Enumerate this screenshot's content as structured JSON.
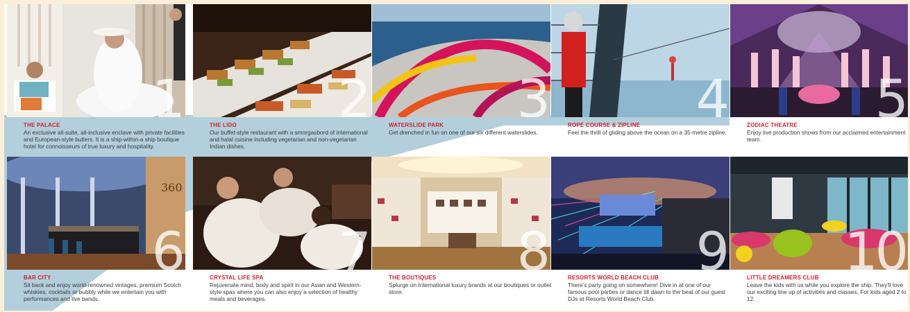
{
  "colors": {
    "accent": "#d0202f",
    "band": "#a6c7d6",
    "page": "#fcefd9"
  },
  "cards": [
    {
      "number": "1",
      "title": "THE PALACE",
      "desc": "An exclusive all-suite, all-inclusive enclave with private facilities and European-style butlers. It is a ship-within-a ship boutique hotel for connoisseurs of true luxury and hospitality."
    },
    {
      "number": "2",
      "title": "THE LIDO",
      "desc": "Our buffet-style restaurant with a smorgasbord of international and halal cuisine including vegetarian and non-vegetarian Indian dishes."
    },
    {
      "number": "3",
      "title": "WATERSLIDE PARK",
      "desc": "Get drenched in fun on one of our six different waterslides."
    },
    {
      "number": "4",
      "title": "ROPE COURSE & ZIPLINE",
      "desc": "Feel the thrill of gliding above the ocean on a 35-metre zipline."
    },
    {
      "number": "5",
      "title": "ZODIAC THEATRE",
      "desc": "Enjoy live production shows from our acclaimed entertainment team."
    },
    {
      "number": "6",
      "title": "BAR CITY",
      "desc": "Sit back and enjoy world-renowned vintages, premium Scotch whiskies, cocktails or bubbly while we entertain you with performances and live bands."
    },
    {
      "number": "7",
      "title": "CRYSTAL LIFE SPA",
      "desc": "Rejuvenate mind, body and spirit in our Asian and Western-style spas where you can also enjoy a selection of healthy meals and beverages."
    },
    {
      "number": "8",
      "title": "THE BOUTIQUES",
      "desc": "Splurge on International luxury brands at our boutiques or outlet store."
    },
    {
      "number": "9",
      "title": "RESORTS WORLD BEACH CLUB",
      "desc": "There's party going on somewhere! Dive in at one of our famous pool parties or dance till dawn to the beat of our guest DJs at Resorts World Beach Club."
    },
    {
      "number": "10",
      "title": "LITTLE DREAMERS CLUB",
      "desc": "Leave the kids with us while you explore the ship. They'll love our exciting line up of activities and classes. For kids aged 2 to 12."
    }
  ]
}
